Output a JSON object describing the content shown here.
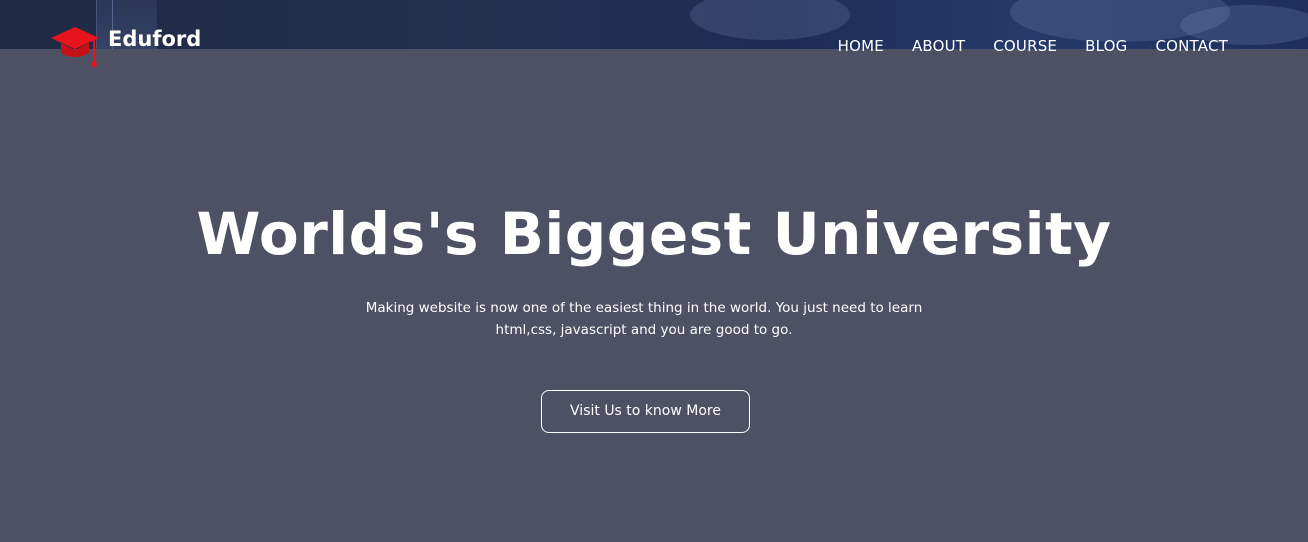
{
  "brand": {
    "name": "Eduford",
    "icon": "graduation-cap-icon",
    "icon_color": "#e8141c"
  },
  "nav": {
    "items": [
      {
        "label": "HOME"
      },
      {
        "label": "ABOUT"
      },
      {
        "label": "COURSE"
      },
      {
        "label": "BLOG"
      },
      {
        "label": "CONTACT"
      }
    ]
  },
  "hero": {
    "title": "Worlds's Biggest University",
    "subtitle": "Making website is now one of the easiest thing in the world. You just need to learn html,css, javascript and you are good to go.",
    "cta_label": "Visit Us to know More"
  },
  "colors": {
    "overlay": "#4e5064",
    "text": "#ffffff",
    "accent": "#e8141c"
  }
}
